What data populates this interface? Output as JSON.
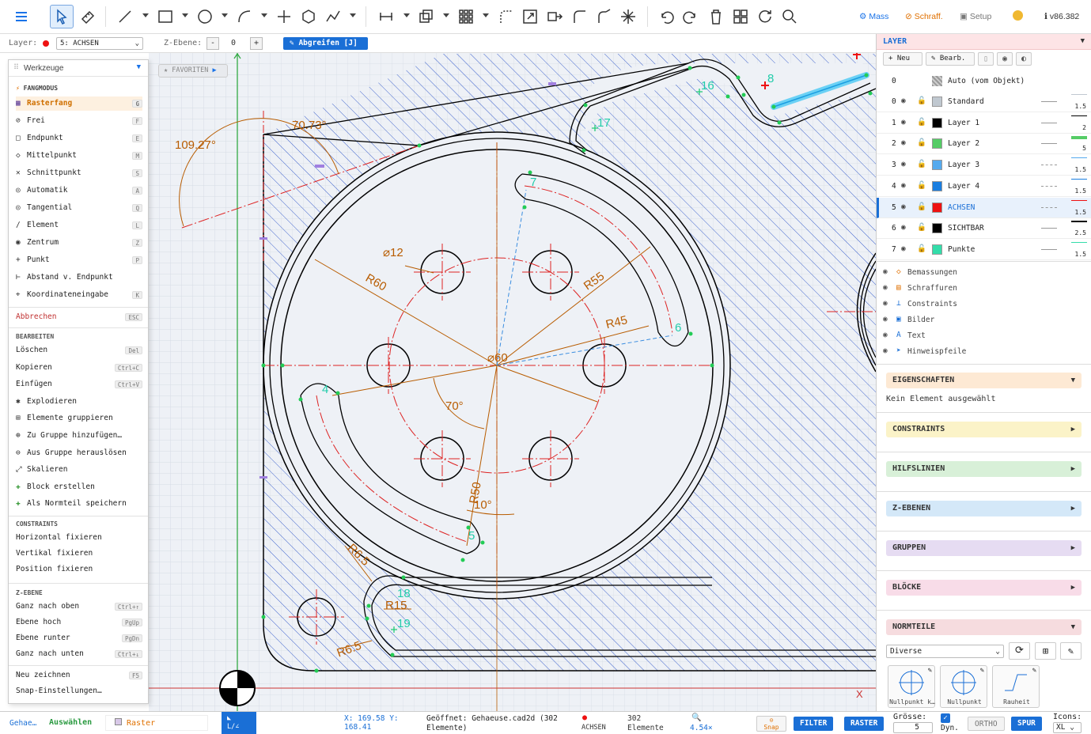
{
  "toolbar": {
    "mass_label": "Mass",
    "schraff_label": "Schraff.",
    "setup_label": "Setup",
    "version": "v86.382"
  },
  "subbar": {
    "layer_label": "Layer:",
    "layer_value": "5: ACHSEN",
    "zebene_label": "Z-Ebene:",
    "zebene_minus": "-",
    "zebene_value": "0",
    "zebene_plus": "+",
    "abgreifen_label": "Abgreifen [J]"
  },
  "favoriten_label": "FAVORITEN",
  "menu": {
    "title": "Werkzeuge",
    "fang_header": "FANGMODUS",
    "fang_items": [
      {
        "label": "Rasterfang",
        "key": "G",
        "icon": "grid-icon"
      },
      {
        "label": "Frei",
        "key": "F",
        "icon": "free-icon"
      },
      {
        "label": "Endpunkt",
        "key": "E",
        "icon": "endpoint-icon"
      },
      {
        "label": "Mittelpunkt",
        "key": "M",
        "icon": "midpoint-icon"
      },
      {
        "label": "Schnittpunkt",
        "key": "S",
        "icon": "intersection-icon"
      },
      {
        "label": "Automatik",
        "key": "A",
        "icon": "auto-icon"
      },
      {
        "label": "Tangential",
        "key": "Q",
        "icon": "tangent-icon"
      },
      {
        "label": "Element",
        "key": "L",
        "icon": "element-icon"
      },
      {
        "label": "Zentrum",
        "key": "Z",
        "icon": "center-icon"
      },
      {
        "label": "Punkt",
        "key": "P",
        "icon": "point-icon"
      },
      {
        "label": "Abstand v. Endpunkt",
        "key": "",
        "icon": "distance-icon"
      },
      {
        "label": "Koordinateneingabe",
        "key": "K",
        "icon": "coordinate-icon"
      }
    ],
    "abbrechen": {
      "label": "Abbrechen",
      "key": "ESC"
    },
    "bearbeiten_header": "BEARBEITEN",
    "bearbeiten_items": [
      {
        "label": "Löschen",
        "key": "Del"
      },
      {
        "label": "Kopieren",
        "key": "Ctrl+C"
      },
      {
        "label": "Einfügen",
        "key": "Ctrl+V"
      },
      {
        "label": "Explodieren",
        "key": ""
      },
      {
        "label": "Elemente gruppieren",
        "key": ""
      },
      {
        "label": "Zu Gruppe hinzufügen…",
        "key": ""
      },
      {
        "label": "Aus Gruppe herauslösen",
        "key": ""
      },
      {
        "label": "Skalieren",
        "key": ""
      },
      {
        "label": "Block erstellen",
        "key": ""
      },
      {
        "label": "Als Normteil speichern",
        "key": ""
      }
    ],
    "constraints_header": "CONSTRAINTS",
    "constraints_items": [
      {
        "label": "Horizontal fixieren"
      },
      {
        "label": "Vertikal fixieren"
      },
      {
        "label": "Position fixieren"
      }
    ],
    "zebene_header": "Z-EBENE",
    "zebene_items": [
      {
        "label": "Ganz nach oben",
        "key": "Ctrl+↑"
      },
      {
        "label": "Ebene hoch",
        "key": "PgUp"
      },
      {
        "label": "Ebene runter",
        "key": "PgDn"
      },
      {
        "label": "Ganz nach unten",
        "key": "Ctrl+↓"
      }
    ],
    "neu_zeichnen": {
      "label": "Neu zeichnen",
      "key": "F5"
    },
    "snap_settings": "Snap-Einstellungen…"
  },
  "layer_panel": {
    "title": "LAYER",
    "buttons": {
      "neu": "Neu",
      "bearb": "Bearb."
    },
    "auto_row": {
      "num": "0",
      "name": "Auto (vom Objekt)"
    },
    "layers": [
      {
        "num": "0",
        "name": "Standard",
        "color": "#c0c8d0",
        "width": "1.5"
      },
      {
        "num": "1",
        "name": "Layer 1",
        "color": "#000000",
        "width": "2"
      },
      {
        "num": "2",
        "name": "Layer 2",
        "color": "#55cc66",
        "width": "5"
      },
      {
        "num": "3",
        "name": "Layer 3",
        "color": "#55aaee",
        "width": "1.5"
      },
      {
        "num": "4",
        "name": "Layer 4",
        "color": "#1a7ee0",
        "width": "1.5"
      },
      {
        "num": "5",
        "name": "ACHSEN",
        "color": "#ee1111",
        "width": "1.5"
      },
      {
        "num": "6",
        "name": "SICHTBAR",
        "color": "#000000",
        "width": "2.5"
      },
      {
        "num": "7",
        "name": "Punkte",
        "color": "#33ddaa",
        "width": "1.5"
      }
    ],
    "categories": [
      "Bemassungen",
      "Schraffuren",
      "Constraints",
      "Bilder",
      "Text",
      "Hinweispfeile"
    ]
  },
  "panels": {
    "eigenschaften": "EIGENSCHAFTEN",
    "no_selection": "Kein Element ausgewählt",
    "constraints": "CONSTRAINTS",
    "hilfslinien": "HILFSLINIEN",
    "zebenen": "Z-EBENEN",
    "gruppen": "GRUPPEN",
    "bloecke": "BLÖCKE",
    "normteile": "NORMTEILE",
    "normteile_select": "Diverse",
    "normteile_items": [
      "Nullpunkt k…",
      "Nullpunkt",
      "Rauheit"
    ]
  },
  "drawing": {
    "dims": [
      "109.27°",
      "70.73°",
      "⌀12",
      "R60",
      "R55",
      "R45",
      "⌀60",
      "70°",
      "R50",
      "10°",
      "R6.5",
      "R15",
      "R6.5"
    ],
    "points": [
      "16",
      "8",
      "17",
      "7",
      "6",
      "4",
      "5",
      "18",
      "19"
    ],
    "axis_x": "X"
  },
  "bottom": {
    "file_short": "Gehae…",
    "mode": "Auswählen",
    "raster": "Raster",
    "coords": "X: 169.58 Y: 168.41",
    "opened": "Geöffnet: Gehaeuse.cad2d (302 Elemente)",
    "layer": "ACHSEN",
    "elements": "302 Elemente",
    "zoom": "4.54×",
    "snap": "Snap",
    "filter": "FILTER",
    "raster_btn": "RASTER",
    "groesse_label": "Grösse:",
    "groesse_value": "5",
    "dyn_label": "Dyn.",
    "ortho": "ORTHO",
    "spur": "SPUR",
    "icons_label": "Icons:",
    "icons_value": "XL"
  }
}
